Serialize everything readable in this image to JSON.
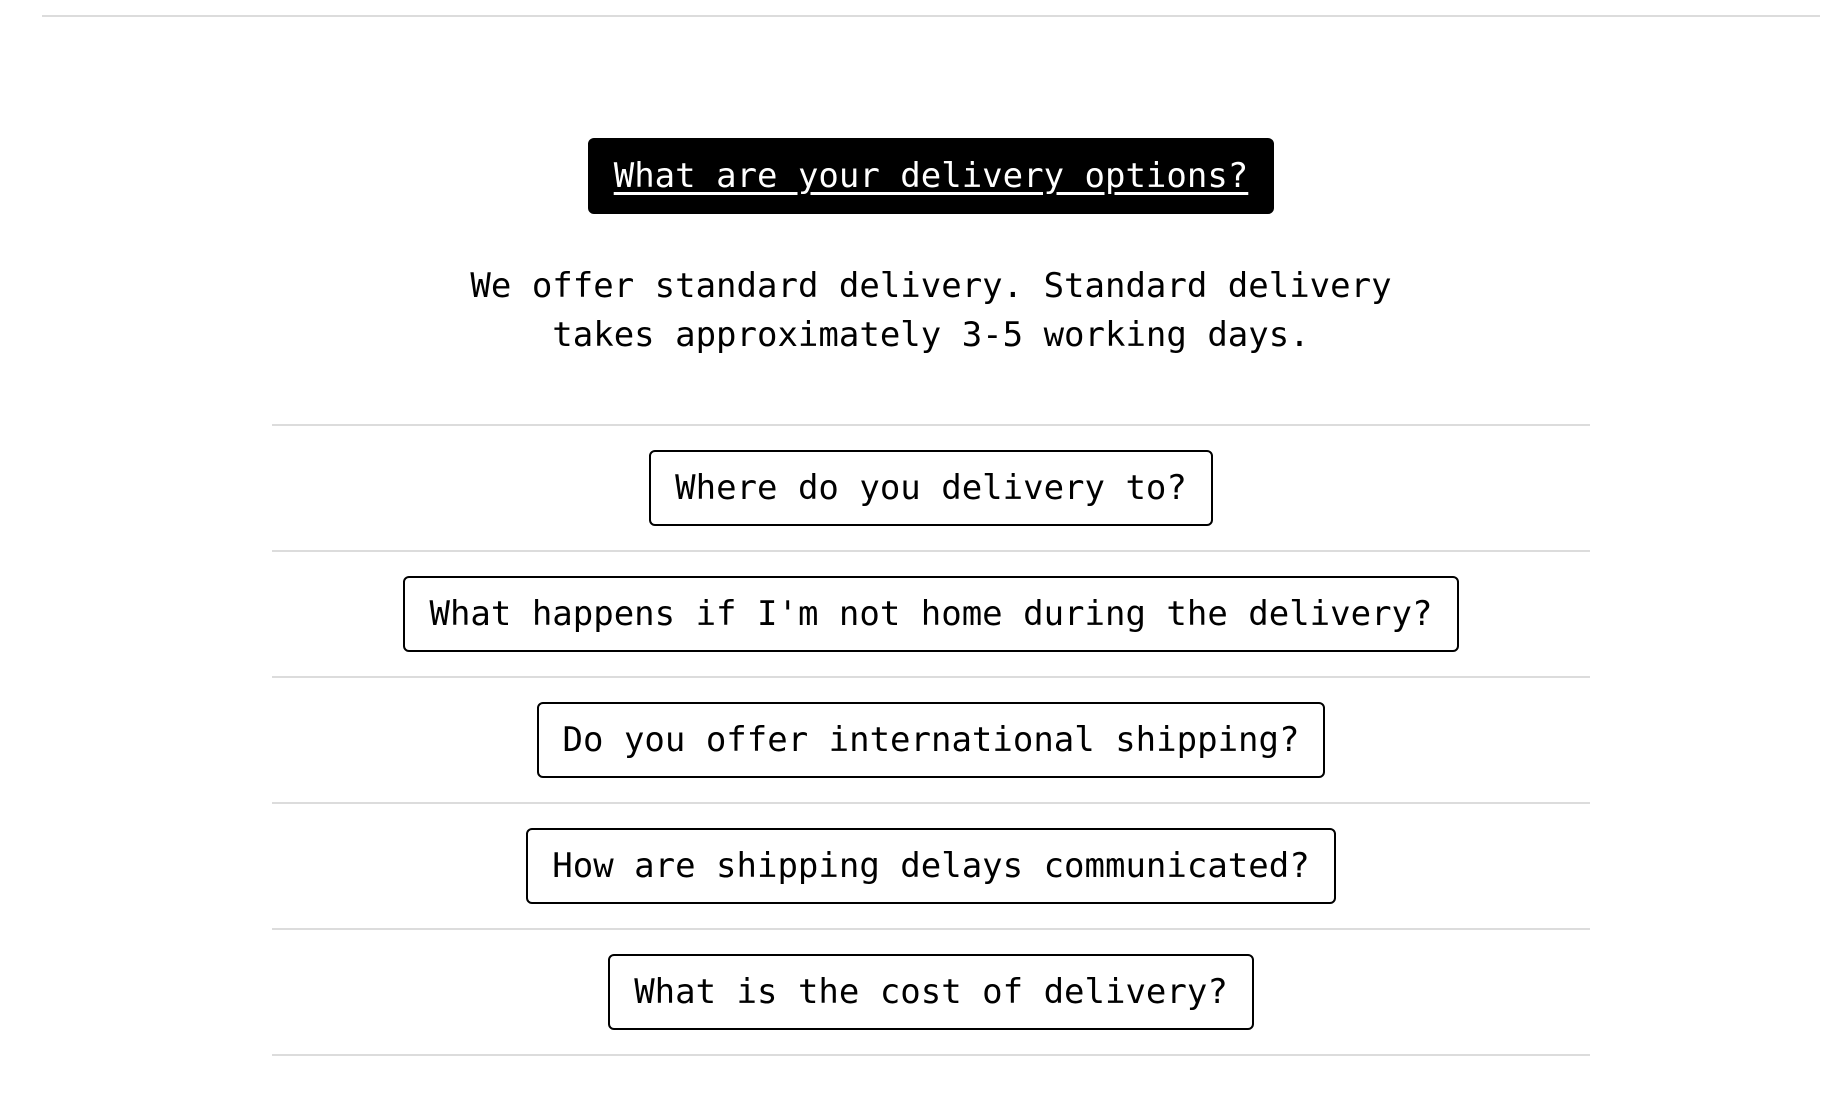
{
  "faq": {
    "items": [
      {
        "question": "What are your delivery options?",
        "answer": "We offer standard delivery. Standard delivery takes approximately 3-5 working days.",
        "expanded": true
      },
      {
        "question": "Where do you delivery to?",
        "expanded": false
      },
      {
        "question": "What happens if I'm not home during the delivery?",
        "expanded": false
      },
      {
        "question": "Do you offer international shipping?",
        "expanded": false
      },
      {
        "question": "How are shipping delays communicated?",
        "expanded": false
      },
      {
        "question": "What is the cost of delivery?",
        "expanded": false
      }
    ]
  }
}
